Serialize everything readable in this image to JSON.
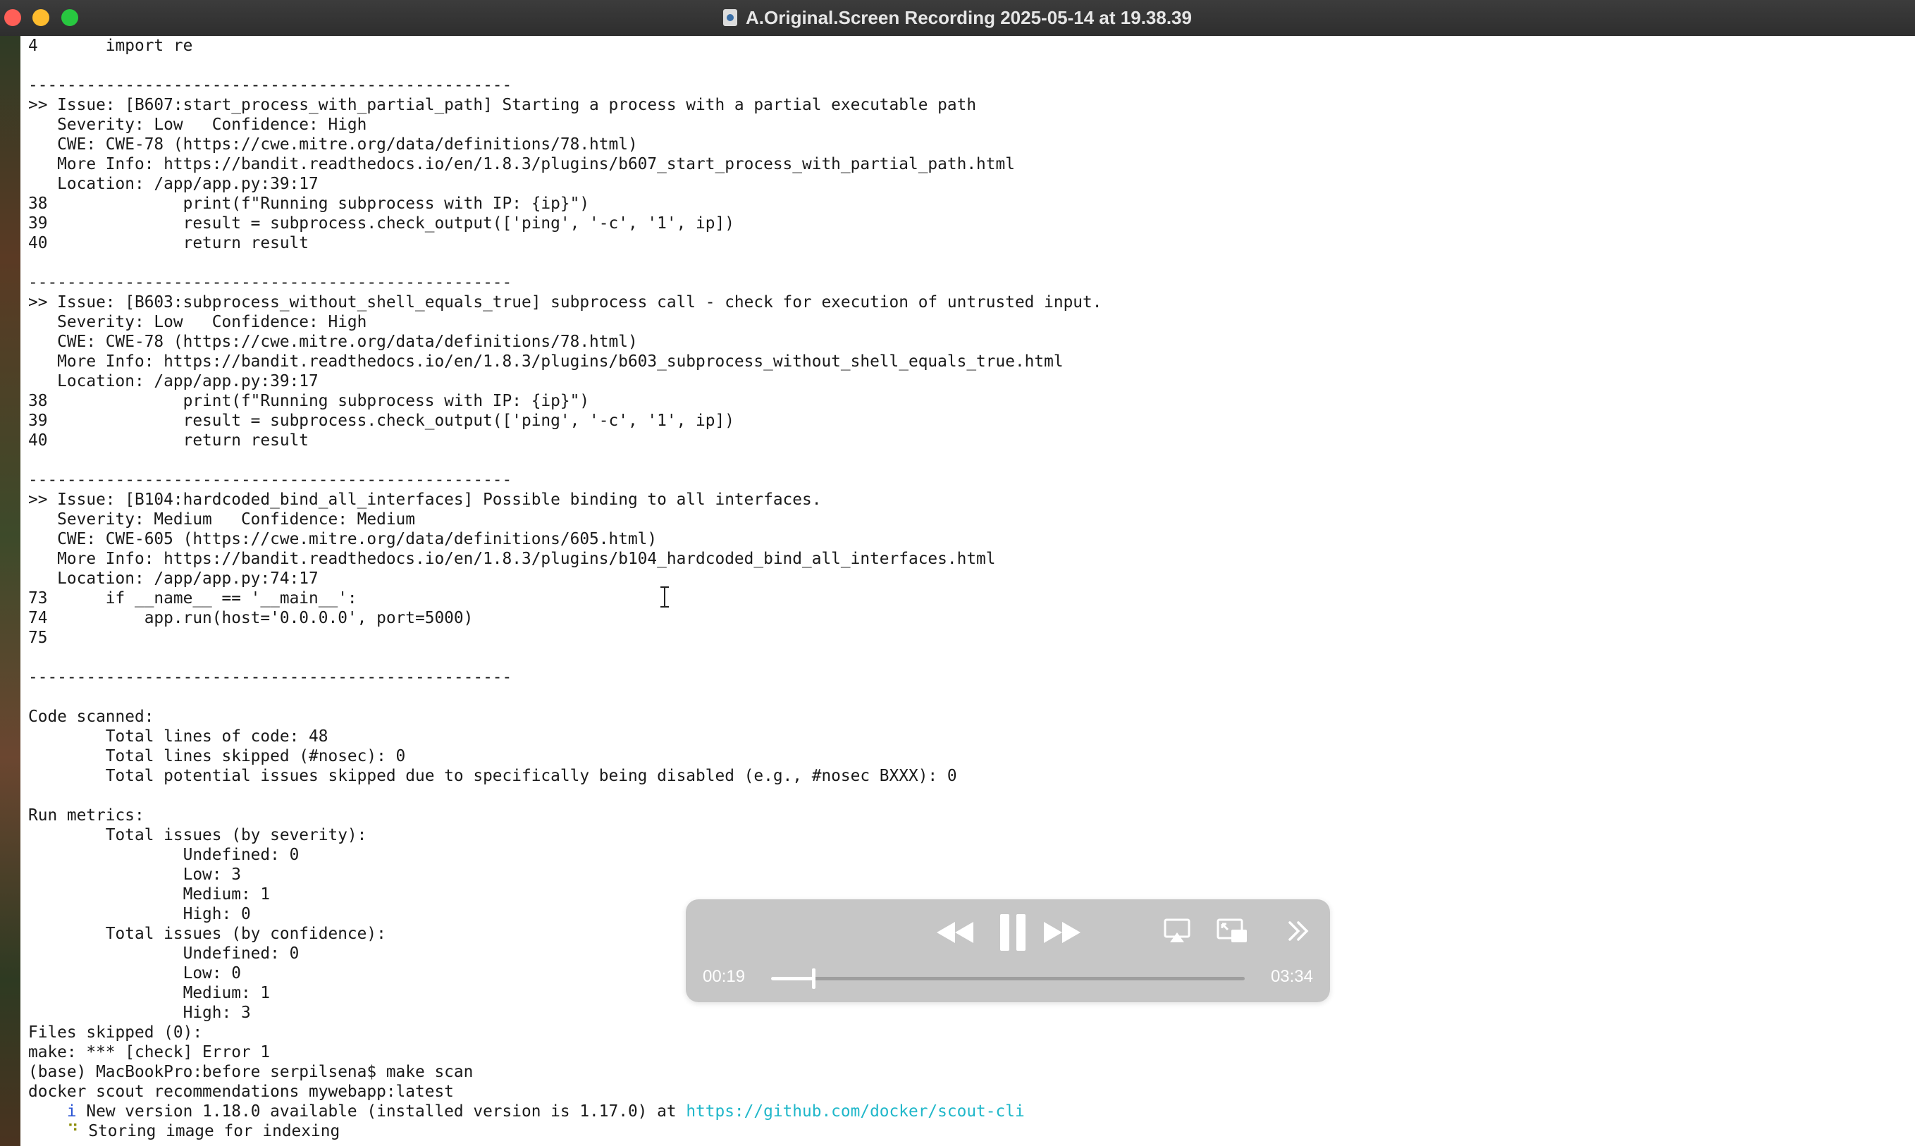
{
  "window": {
    "title": "A.Original.Screen Recording 2025-05-14 at 19.38.39"
  },
  "terminal": {
    "lines": [
      "4       import re",
      "",
      "--------------------------------------------------",
      ">> Issue: [B607:start_process_with_partial_path] Starting a process with a partial executable path",
      "   Severity: Low   Confidence: High",
      "   CWE: CWE-78 (https://cwe.mitre.org/data/definitions/78.html)",
      "   More Info: https://bandit.readthedocs.io/en/1.8.3/plugins/b607_start_process_with_partial_path.html",
      "   Location: /app/app.py:39:17",
      "38              print(f\"Running subprocess with IP: {ip}\")",
      "39              result = subprocess.check_output(['ping', '-c', '1', ip])",
      "40              return result",
      "",
      "--------------------------------------------------",
      ">> Issue: [B603:subprocess_without_shell_equals_true] subprocess call - check for execution of untrusted input.",
      "   Severity: Low   Confidence: High",
      "   CWE: CWE-78 (https://cwe.mitre.org/data/definitions/78.html)",
      "   More Info: https://bandit.readthedocs.io/en/1.8.3/plugins/b603_subprocess_without_shell_equals_true.html",
      "   Location: /app/app.py:39:17",
      "38              print(f\"Running subprocess with IP: {ip}\")",
      "39              result = subprocess.check_output(['ping', '-c', '1', ip])",
      "40              return result",
      "",
      "--------------------------------------------------",
      ">> Issue: [B104:hardcoded_bind_all_interfaces] Possible binding to all interfaces.",
      "   Severity: Medium   Confidence: Medium",
      "   CWE: CWE-605 (https://cwe.mitre.org/data/definitions/605.html)",
      "   More Info: https://bandit.readthedocs.io/en/1.8.3/plugins/b104_hardcoded_bind_all_interfaces.html",
      "   Location: /app/app.py:74:17",
      "73      if __name__ == '__main__':",
      "74          app.run(host='0.0.0.0', port=5000)",
      "75",
      "",
      "--------------------------------------------------",
      "",
      "Code scanned:",
      "        Total lines of code: 48",
      "        Total lines skipped (#nosec): 0",
      "        Total potential issues skipped due to specifically being disabled (e.g., #nosec BXXX): 0",
      "",
      "Run metrics:",
      "        Total issues (by severity):",
      "                Undefined: 0",
      "                Low: 3",
      "                Medium: 1",
      "                High: 0",
      "        Total issues (by confidence):",
      "                Undefined: 0",
      "                Low: 0",
      "                Medium: 1",
      "                High: 3",
      "Files skipped (0):",
      "make: *** [check] Error 1",
      "(base) MacBookPro:before serpilsena$ make scan",
      "docker scout recommendations mywebapp:latest"
    ],
    "info_line": {
      "icon": "i",
      "text": " New version 1.18.0 available (installed version is 1.17.0) at ",
      "link": "https://github.com/docker/scout-cli"
    },
    "spinner_line": {
      "icon": "⠙",
      "text": " Storing image for indexing"
    }
  },
  "player": {
    "current_time": "00:19",
    "total_time": "03:34",
    "progress": 0.089,
    "icons": {
      "rewind": "rewind-icon",
      "pause": "pause-icon",
      "forward": "fast-forward-icon",
      "airplay": "airplay-icon",
      "pip": "picture-in-picture-icon",
      "more": "chevron-double-right-icon"
    }
  }
}
